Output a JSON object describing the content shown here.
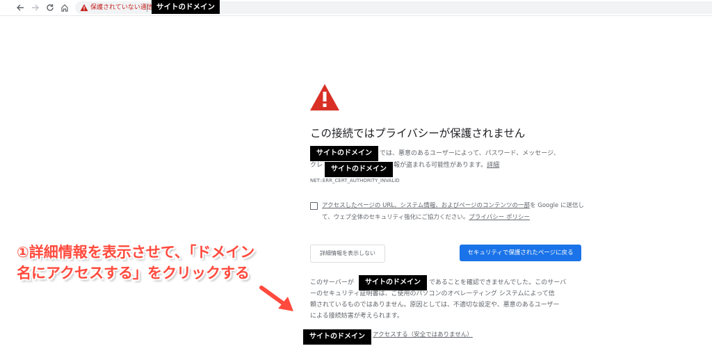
{
  "browser": {
    "back_icon": "arrow-left-icon",
    "forward_icon": "arrow-right-icon",
    "reload_icon": "reload-icon",
    "home_icon": "home-icon",
    "security_status": "保護されていない通信",
    "url_redacted": "サイトのドメイン"
  },
  "colors": {
    "warning_red": "#d93025",
    "primary_blue": "#1a73e8",
    "annotation_red": "#ff4a3d"
  },
  "interstitial": {
    "icon": "warning-triangle-icon",
    "title": "この接続ではプライバシーが保護されません",
    "para1_domain_redacted": "サイトのドメイン",
    "para1_line1_rest": "では、悪意のあるユーザーによって、パスワード、メッセージ、",
    "para1_line2_prefix": "クレ",
    "para1_line2_redacted": "サイトのドメイン",
    "para1_line2_rest": "報が盗まれる可能性があります。",
    "para1_details_link": "詳細",
    "error_code": "NET::ERR_CERT_AUTHORITY_INVALID",
    "checkbox_line1_link": "アクセスしたページの URL、システム情報、およびページのコンテンツの一部",
    "checkbox_line1_rest": "を Google に送信し",
    "checkbox_line2_text": "て、ウェブ全体のセキュリティ強化にご協力ください。",
    "checkbox_line2_link": "プライバシー ポリシー",
    "hide_details_button": "詳細情報を表示しない",
    "back_button": "セキュリティで保護されたページに戻る",
    "explain_line1_prefix": "このサーバーが",
    "explain_line1_redacted": "サイトのドメイン",
    "explain_line1_rest": "であることを確認できませんでした。このサーバ",
    "explain_line2": "ーのセキュリティ証明書は、ご使用のパソコンのオペレーティング システムによって信",
    "explain_line3": "頼されているものではありません。原因としては、不適切な設定や、悪意のあるユーザー",
    "explain_line4": "による接続妨害が考えられます。",
    "proceed_redacted": "サイトのドメイン",
    "proceed_link_text": "アクセスする（安全ではありません）"
  },
  "annotation": {
    "line1": "①詳細情報を表示させて、「ドメイン",
    "line2": "名にアクセスする」をクリックする",
    "arrow_icon": "arrow-down-right-icon"
  }
}
